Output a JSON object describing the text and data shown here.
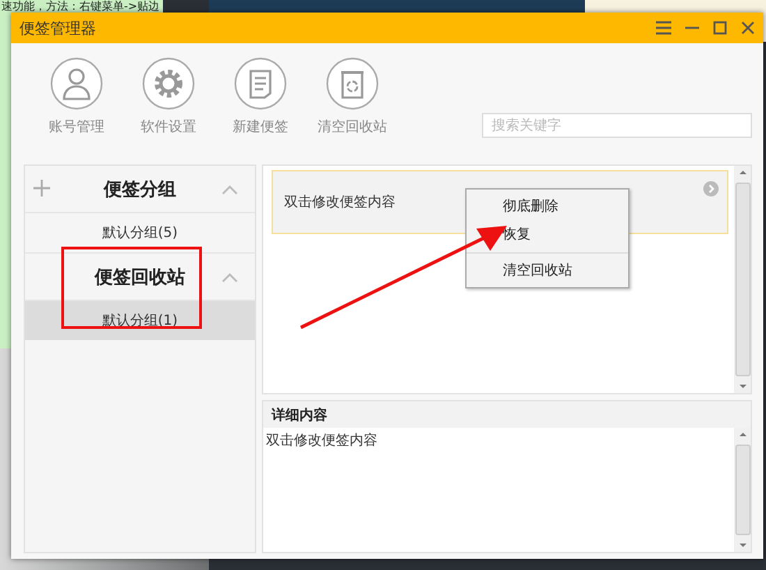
{
  "background_note": {
    "text": "速功能，方法：右键菜单->贴边"
  },
  "window": {
    "title": "便签管理器"
  },
  "toolbar": [
    {
      "label": "账号管理",
      "kind": "person"
    },
    {
      "label": "软件设置",
      "kind": "gear"
    },
    {
      "label": "新建便签",
      "kind": "note"
    },
    {
      "label": "清空回收站",
      "kind": "bin"
    }
  ],
  "search": {
    "placeholder": "搜索关键字"
  },
  "sidebar": {
    "sections": [
      {
        "title": "便签分组",
        "has_add": true,
        "expanded": true,
        "items": [
          {
            "label": "默认分组(5)",
            "selected": false
          }
        ]
      },
      {
        "title": "便签回收站",
        "has_add": false,
        "expanded": true,
        "items": [
          {
            "label": "默认分组(1)",
            "selected": true
          }
        ]
      }
    ]
  },
  "notes": [
    {
      "text": "双击修改便签内容"
    }
  ],
  "context_menu": {
    "items": [
      {
        "label": "彻底删除",
        "separator_before": false
      },
      {
        "label": "恢复",
        "separator_before": false
      },
      {
        "label": "清空回收站",
        "separator_before": true
      }
    ]
  },
  "details": {
    "title": "详细内容",
    "text": "双击修改便签内容"
  }
}
